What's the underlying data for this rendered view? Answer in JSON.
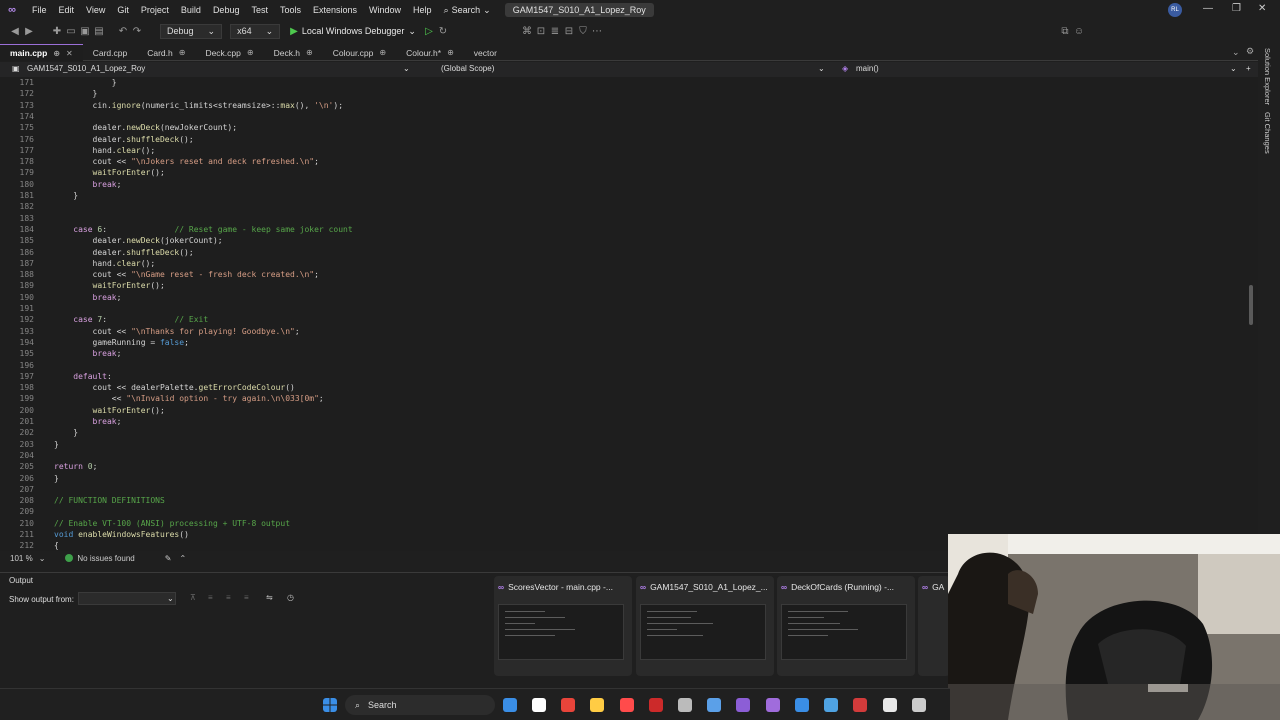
{
  "titlebar": {
    "menus": [
      "File",
      "Edit",
      "View",
      "Git",
      "Project",
      "Build",
      "Debug",
      "Test",
      "Tools",
      "Extensions",
      "Window",
      "Help"
    ],
    "search_label": "Search",
    "solution_name": "GAM1547_S010_A1_Lopez_Roy",
    "avatar_initials": "RL"
  },
  "toolbar": {
    "config": "Debug",
    "platform": "x64",
    "run_label": "Local Windows Debugger"
  },
  "tabs": [
    {
      "label": "main.cpp",
      "active": true
    },
    {
      "label": "Card.cpp"
    },
    {
      "label": "Card.h"
    },
    {
      "label": "Deck.cpp"
    },
    {
      "label": "Deck.h"
    },
    {
      "label": "Colour.cpp"
    },
    {
      "label": "Colour.h*"
    },
    {
      "label": "vector"
    }
  ],
  "navbar": {
    "project": "GAM1547_S010_A1_Lopez_Roy",
    "scope": "(Global Scope)",
    "member": "main()"
  },
  "side_panels": [
    "Solution Explorer",
    "Git Changes"
  ],
  "code_lines": [
    {
      "n": "171",
      "t": "            }"
    },
    {
      "n": "172",
      "t": "        }"
    },
    {
      "n": "173",
      "t": "        cin.ignore(numeric_limits<streamsize>::max(), '\\n');"
    },
    {
      "n": "174",
      "t": ""
    },
    {
      "n": "175",
      "t": "        dealer.newDeck(newJokerCount);"
    },
    {
      "n": "176",
      "t": "        dealer.shuffleDeck();"
    },
    {
      "n": "177",
      "t": "        hand.clear();"
    },
    {
      "n": "178",
      "t": "        cout << \"\\nJokers reset and deck refreshed.\\n\";"
    },
    {
      "n": "179",
      "t": "        waitForEnter();"
    },
    {
      "n": "180",
      "t": "        break;"
    },
    {
      "n": "181",
      "t": "    }"
    },
    {
      "n": "182",
      "t": ""
    },
    {
      "n": "183",
      "t": ""
    },
    {
      "n": "184",
      "t": "    case 6:              // Reset game - keep same joker count"
    },
    {
      "n": "185",
      "t": "        dealer.newDeck(jokerCount);"
    },
    {
      "n": "186",
      "t": "        dealer.shuffleDeck();"
    },
    {
      "n": "187",
      "t": "        hand.clear();"
    },
    {
      "n": "188",
      "t": "        cout << \"\\nGame reset - fresh deck created.\\n\";"
    },
    {
      "n": "189",
      "t": "        waitForEnter();"
    },
    {
      "n": "190",
      "t": "        break;"
    },
    {
      "n": "191",
      "t": ""
    },
    {
      "n": "192",
      "t": "    case 7:              // Exit"
    },
    {
      "n": "193",
      "t": "        cout << \"\\nThanks for playing! Goodbye.\\n\";"
    },
    {
      "n": "194",
      "t": "        gameRunning = false;"
    },
    {
      "n": "195",
      "t": "        break;"
    },
    {
      "n": "196",
      "t": ""
    },
    {
      "n": "197",
      "t": "    default:"
    },
    {
      "n": "198",
      "t": "        cout << dealerPalette.getErrorCodeColour()"
    },
    {
      "n": "199",
      "t": "            << \"\\nInvalid option - try again.\\n\\033[0m\";"
    },
    {
      "n": "200",
      "t": "        waitForEnter();"
    },
    {
      "n": "201",
      "t": "        break;"
    },
    {
      "n": "202",
      "t": "    }"
    },
    {
      "n": "203",
      "t": "}"
    },
    {
      "n": "204",
      "t": ""
    },
    {
      "n": "205",
      "t": "return 0;"
    },
    {
      "n": "206",
      "t": "}"
    },
    {
      "n": "207",
      "t": ""
    },
    {
      "n": "208",
      "t": "// FUNCTION DEFINITIONS"
    },
    {
      "n": "209",
      "t": ""
    },
    {
      "n": "210",
      "t": "// Enable VT-100 (ANSI) processing + UTF-8 output"
    },
    {
      "n": "211",
      "t": "void enableWindowsFeatures()"
    },
    {
      "n": "212",
      "t": "{"
    }
  ],
  "status": {
    "zoom": "101 %",
    "issues": "No issues found"
  },
  "output": {
    "title": "Output",
    "show_from_label": "Show output from:"
  },
  "previews": [
    {
      "title": "ScoresVector - main.cpp -..."
    },
    {
      "title": "GAM1547_S010_A1_Lopez_..."
    },
    {
      "title": "DeckOfCards (Running) -..."
    },
    {
      "title": "GA"
    }
  ],
  "taskbar": {
    "search_label": "Search",
    "colors": [
      "#3a8ee6",
      "#ffffff",
      "#e8443a",
      "#ffcc44",
      "#ff4b4b",
      "#cc2a2a",
      "#bbbbbb",
      "#5ba0e8",
      "#8c5ed6",
      "#a06cdc",
      "#3a8ee6",
      "#4fa3e3",
      "#d23b3b",
      "#e8e8e8",
      "#cccccc"
    ]
  }
}
